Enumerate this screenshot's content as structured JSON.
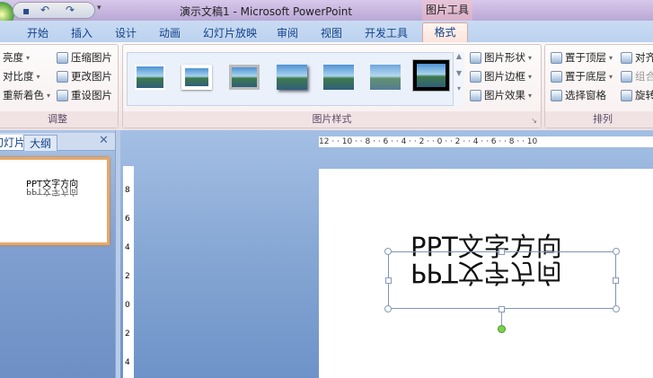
{
  "window": {
    "title": "演示文稿1 - Microsoft PowerPoint",
    "context_tab_group": "图片工具"
  },
  "tabs": [
    "开始",
    "插入",
    "设计",
    "动画",
    "幻灯片放映",
    "审阅",
    "视图",
    "开发工具",
    "格式"
  ],
  "active_tab": "格式",
  "ribbon": {
    "adjust": {
      "label": "调整",
      "buttons": [
        "亮度",
        "对比度",
        "重新着色",
        "压缩图片",
        "更改图片",
        "重设图片"
      ]
    },
    "picture_styles": {
      "label": "图片样式",
      "buttons": [
        "图片形状",
        "图片边框",
        "图片效果"
      ],
      "style_count": 7
    },
    "arrange": {
      "label": "排列",
      "buttons": [
        "置于顶层",
        "置于底层",
        "选择窗格",
        "对齐",
        "组合",
        "旋转"
      ]
    }
  },
  "left_pane": {
    "tabs": [
      "幻灯片",
      "大纲"
    ],
    "close": "✕"
  },
  "slide_thumb": {
    "text": "PPT文字方向",
    "mirrored": "PPT文字方向"
  },
  "ruler": {
    "horizontal": "12 · · 10 · · 8 · · 6 · · 4 · · 2 · · 0 · · 2 · · 4 · · 6 · · 8 · · 10",
    "vertical": [
      "8",
      "6",
      "4",
      "2",
      "0",
      "2",
      "4"
    ]
  },
  "slide": {
    "text": "PPT文字方向",
    "mirrored_text": "PPT文字方向"
  }
}
